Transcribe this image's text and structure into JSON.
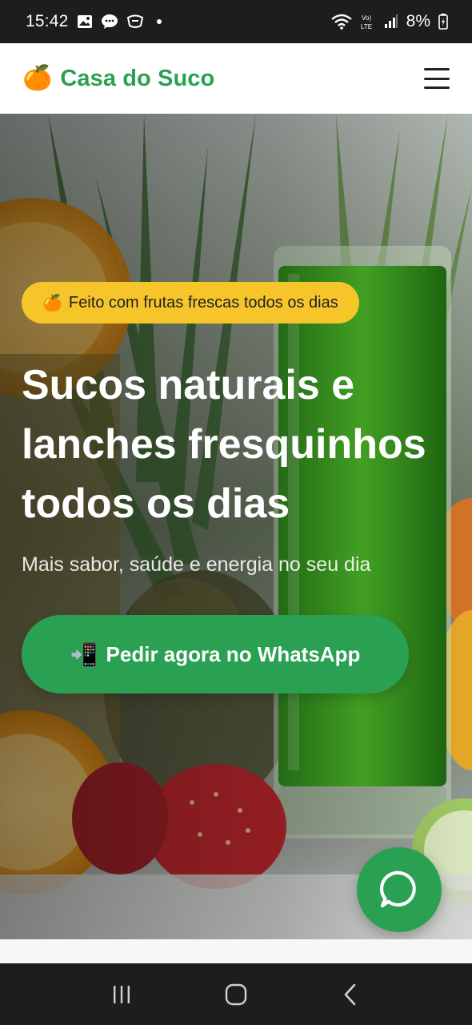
{
  "status_bar": {
    "time": "15:42",
    "battery": "8%",
    "icons": [
      "image-icon",
      "chat-icon",
      "app-icon",
      "wifi-icon",
      "volte-icon",
      "signal-icon",
      "battery-icon"
    ]
  },
  "header": {
    "brand_emoji": "🍊",
    "brand_name": "Casa do Suco",
    "menu_icon": "hamburger-menu-icon"
  },
  "hero": {
    "badge_emoji": "🍊",
    "badge_text": "Feito com frutas frescas todos os dias",
    "title": "Sucos naturais e lanches fresquinhos todos os dias",
    "subtitle": "Mais sabor, saúde e energia no seu dia",
    "cta_emoji": "📲",
    "cta_label": "Pedir agora no WhatsApp"
  },
  "floating_button": {
    "icon": "whatsapp-icon"
  },
  "nav_bar": {
    "icons": [
      "recents-icon",
      "home-icon",
      "back-icon"
    ]
  },
  "colors": {
    "brand_green": "#2aa152",
    "badge_yellow": "#f5c52a",
    "status_bar": "#1d1d1f"
  }
}
